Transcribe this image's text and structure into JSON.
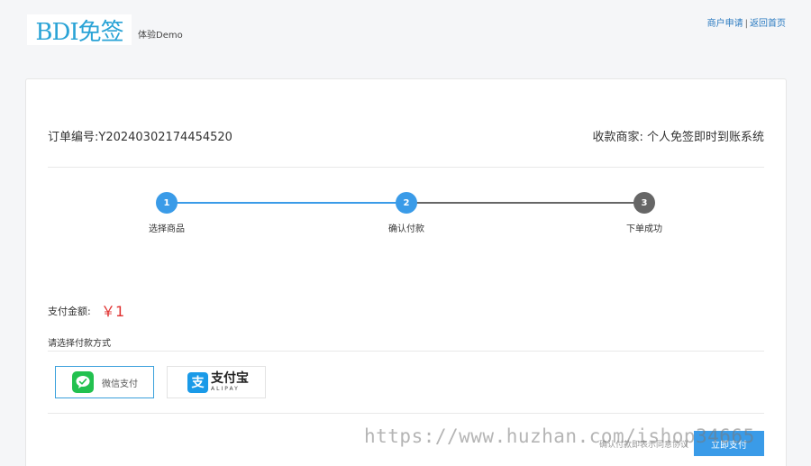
{
  "header": {
    "logo_text": "BDI免签",
    "demo_label": "体验Demo",
    "links": {
      "apply": "商户申请",
      "separator": "|",
      "home": "返回首页"
    }
  },
  "order": {
    "order_no_label": "订单编号:",
    "order_no": "Y20240302174454520",
    "merchant_label": "收款商家:",
    "merchant_name": "个人免签即时到账系统"
  },
  "steps": [
    {
      "num": "1",
      "label": "选择商品",
      "state": "done"
    },
    {
      "num": "2",
      "label": "确认付款",
      "state": "active"
    },
    {
      "num": "3",
      "label": "下单成功",
      "state": "pending"
    }
  ],
  "payment": {
    "amount_label": "支付金额:",
    "amount": "￥1",
    "method_label": "请选择付款方式",
    "methods": [
      {
        "name": "微信支付",
        "icon": "wechat-icon",
        "selected": true
      },
      {
        "name_cn": "支付宝",
        "name_en": "ALIPAY",
        "icon": "alipay-icon",
        "selected": false
      }
    ],
    "hint": "确认付款即表示同意协议",
    "submit_label": "立即支付"
  },
  "watermark": "https://www.huzhan.com/ishop34665",
  "colors": {
    "accent": "#3a9be8",
    "amount": "#e0302f",
    "pending_step": "#666666",
    "wechat": "#22c14f",
    "alipay": "#1a9ae8",
    "link": "#2a7ac0"
  }
}
